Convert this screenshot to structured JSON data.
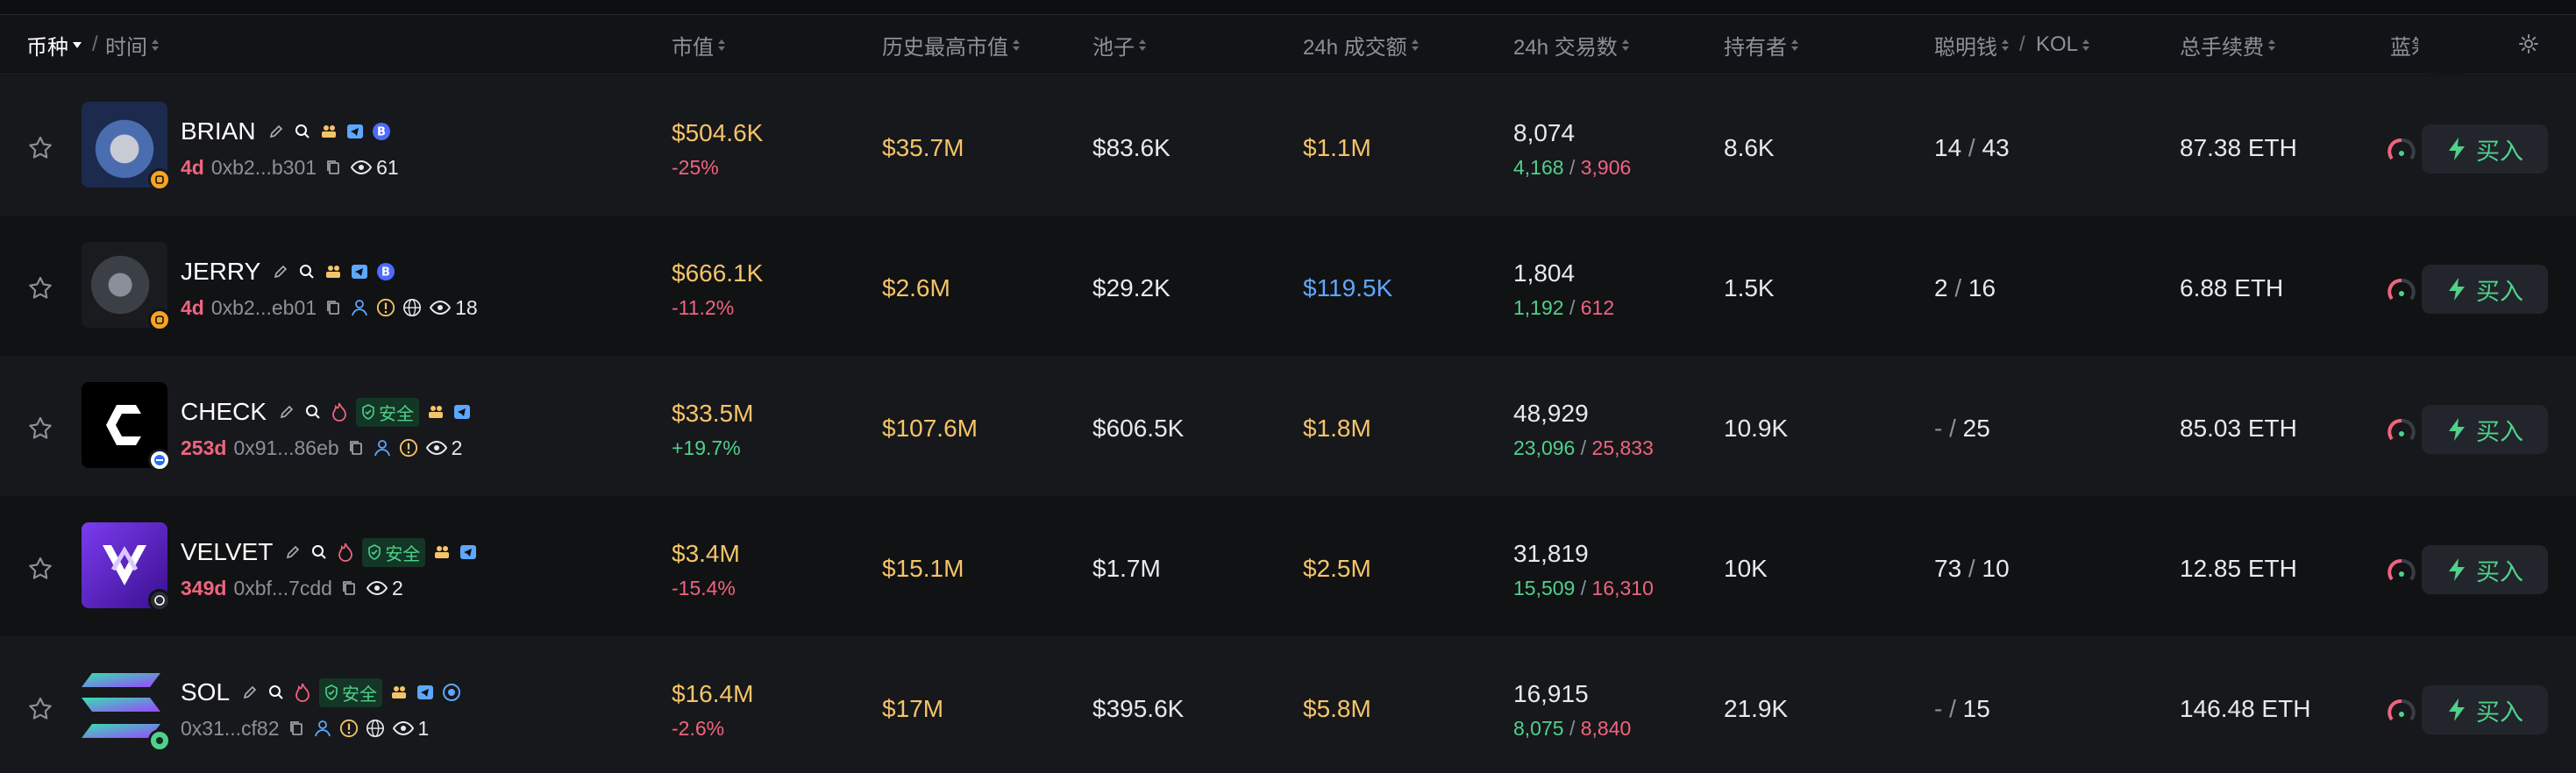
{
  "header": {
    "coin": "币种",
    "time": "时间",
    "market_cap": "市值",
    "ath_market_cap": "历史最高市值",
    "pool": "池子",
    "volume_24h": "24h 成交额",
    "txns_24h": "24h 交易数",
    "holders": "持有者",
    "smart_money": "聪明钱",
    "kol": "KOL",
    "total_fees": "总手续费",
    "blue_chip": "蓝筹"
  },
  "safe_badge": "安全",
  "buy_label": "买入",
  "colors": {
    "background": "#111214",
    "row_alt": "#17181b",
    "gold": "#f5c469",
    "green": "#4fd18b",
    "red": "#f0647f",
    "blue": "#5ea7ff"
  },
  "rows": [
    {
      "symbol": "BRIAN",
      "age": "4d",
      "address": "0xb2...b301",
      "views": "61",
      "market_cap": "$504.6K",
      "change": "-25%",
      "change_dir": "neg",
      "ath": "$35.7M",
      "pool": "$83.6K",
      "volume": "$1.1M",
      "volume_color": "gold",
      "txns": "8,074",
      "buys": "4,168",
      "sells": "3,906",
      "holders": "8.6K",
      "smart": "14",
      "kol": "43",
      "fees": "87.38 ETH",
      "icons": [
        "edit-icon",
        "search-icon",
        "people-icon",
        "telegram-icon",
        "b-badge-icon"
      ]
    },
    {
      "symbol": "JERRY",
      "age": "4d",
      "address": "0xb2...eb01",
      "views": "18",
      "market_cap": "$666.1K",
      "change": "-11.2%",
      "change_dir": "neg",
      "ath": "$2.6M",
      "pool": "$29.2K",
      "volume": "$119.5K",
      "volume_color": "blue",
      "txns": "1,804",
      "buys": "1,192",
      "sells": "612",
      "holders": "1.5K",
      "smart": "2",
      "kol": "16",
      "fees": "6.88 ETH",
      "icons": [
        "edit-icon",
        "search-icon",
        "people-icon",
        "telegram-icon",
        "b-badge-icon"
      ]
    },
    {
      "symbol": "CHECK",
      "age": "253d",
      "address": "0x91...86eb",
      "views": "2",
      "market_cap": "$33.5M",
      "change": "+19.7%",
      "change_dir": "pos",
      "ath": "$107.6M",
      "pool": "$606.5K",
      "volume": "$1.8M",
      "volume_color": "gold",
      "txns": "48,929",
      "buys": "23,096",
      "sells": "25,833",
      "holders": "10.9K",
      "smart": "-",
      "kol": "25",
      "fees": "85.03 ETH",
      "icons": [
        "edit-icon",
        "search-icon",
        "flame-icon",
        "people-icon",
        "telegram-icon"
      ]
    },
    {
      "symbol": "VELVET",
      "age": "349d",
      "address": "0xbf...7cdd",
      "views": "2",
      "market_cap": "$3.4M",
      "change": "-15.4%",
      "change_dir": "neg",
      "ath": "$15.1M",
      "pool": "$1.7M",
      "volume": "$2.5M",
      "volume_color": "gold",
      "txns": "31,819",
      "buys": "15,509",
      "sells": "16,310",
      "holders": "10K",
      "smart": "73",
      "kol": "10",
      "fees": "12.85 ETH",
      "icons": [
        "edit-icon",
        "search-icon",
        "flame-icon",
        "people-icon",
        "telegram-icon"
      ]
    },
    {
      "symbol": "SOL",
      "age": "",
      "address": "0x31...cf82",
      "views": "1",
      "market_cap": "$16.4M",
      "change": "-2.6%",
      "change_dir": "neg",
      "ath": "$17M",
      "pool": "$395.6K",
      "volume": "$5.8M",
      "volume_color": "gold",
      "txns": "16,915",
      "buys": "8,075",
      "sells": "8,840",
      "holders": "21.9K",
      "smart": "-",
      "kol": "15",
      "fees": "146.48 ETH",
      "icons": [
        "edit-icon",
        "search-icon",
        "flame-icon",
        "people-icon",
        "telegram-icon",
        "coin-icon"
      ]
    }
  ]
}
